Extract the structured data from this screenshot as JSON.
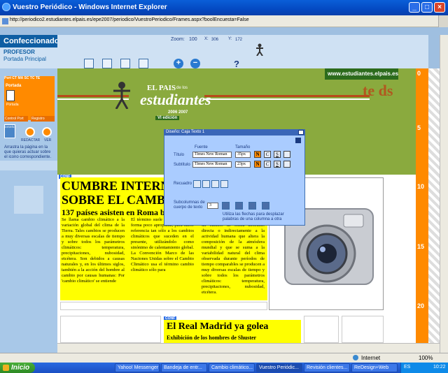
{
  "window": {
    "title": "Vuestro Periódico - Windows Internet Explorer",
    "url": "http://periodico2.estudiantes.elpais.es/epe2007/periodico/VuestroPeriodico/Frames.aspx?boolEncuesta=False"
  },
  "app": {
    "name": "Confeccionador",
    "role": "PROFESOR",
    "home_link": "Portada Principal"
  },
  "toolbar": {
    "zoom_label": "Zoom:",
    "zoom_value": "100",
    "x_label": "X:",
    "x_value": "306",
    "y_label": "Y:",
    "y_value": "172",
    "help": "?"
  },
  "sidebar": {
    "tabs": [
      "Port",
      "CT",
      "MA",
      "SC",
      "TC",
      "TE"
    ],
    "section": "Portada",
    "thumb_label": "Portada",
    "btn_control": "Control Port",
    "btn_registro": "Registro",
    "diseno_label": "DISEÑO",
    "redactar_label": "REDACTAR",
    "ver_label": "VER",
    "hint": "Arrastra la página en la que quieras actuar sobre el icono correspondiente."
  },
  "banner": {
    "site_url": "www.estudiantes.elpais.es",
    "brand": "EL PAIS",
    "brand_suffix": "de los",
    "title": "estudiantes",
    "years": "2006 2007",
    "edition": "VI edición"
  },
  "ruler": {
    "marks": [
      "0",
      "5",
      "10",
      "15",
      "20"
    ]
  },
  "dialog": {
    "title": "Diseño: Caja Texto 1",
    "fuente_label": "Fuente",
    "tamano_label": "Tamaño",
    "titulo_label": "Título",
    "titulo_font": "Times New Roman",
    "titulo_size": "35px",
    "subtitulo_label": "Subtítulo",
    "subtitulo_font": "Times New Roman",
    "subtitulo_size": "23px",
    "recuadro_label": "Recuadro",
    "subcolumnas_label": "Subcolumnas de cuerpo de texto",
    "subcolumnas_value": "3",
    "arrows_hint": "Utiliza las flechas para desplazar palabras de una columna a otra",
    "bold": "N",
    "cursive": "C",
    "underline": "S"
  },
  "article1": {
    "conf": "CONF",
    "headline": "CUMBRE INTERNACIONAL SOBRE EL CAMBIO CLIMÁTICO",
    "subhead": "137 países asisten en Roma bajo",
    "col1": "Se llama cambio climático a la variación global del clima de la Tierra. Tales cambios se producen a muy diversas escalas de tiempo y sobre todos los parámetros climáticos: temperatura, precipitaciones, nubosidad, etcétera. Son debidos a causas naturales y, en los últimos siglos, también a la acción del hombre al cambio por causas humanas: Por 'cambio climático' se entiende",
    "col2": "El término suele ser utilizado de forma poco apropiada, para hacer referencia tan sólo a los cambios climáticos que suceden en el presente, utilizándolo como sinónimo de calentamiento global. La Convención Marco de las Naciones Unidas sobre el Cambio Climático usa el término cambio climático sólo para",
    "col3": "Por 'cambio climático' se entiende un cambio de clima atribuido directa o indirectamente a la actividad humana que altera la composición de la atmósfera mundial y que se suma a la variabilidad natural del clima observada durante períodos de tiempo comparables se producen a muy diversas escalas de tiempo y sobre todos los parámetros climáticos: temperatura, precipitaciones, nubosidad, etcétera."
  },
  "article2": {
    "conf": "CONF",
    "headline": "El Real Madrid ya golea",
    "subhead": "Exhibición de los hombres de Shuster"
  },
  "status": {
    "zone": "Internet",
    "zoom": "100%"
  },
  "taskbar": {
    "start": "Inicio",
    "tasks": [
      "Yahoo! Messenger",
      "Bandeja de entr...",
      "Cambio climático...",
      "Vuestro Periódic...",
      "Revisión clientes...",
      "ReDesign+Web"
    ],
    "lang": "ES",
    "clock": "10:22"
  },
  "colors": {
    "accent": "#0e5ea3",
    "banner_green": "#8aaa3e",
    "highlight": "#ffff00",
    "ruler": "#ff8a00"
  }
}
